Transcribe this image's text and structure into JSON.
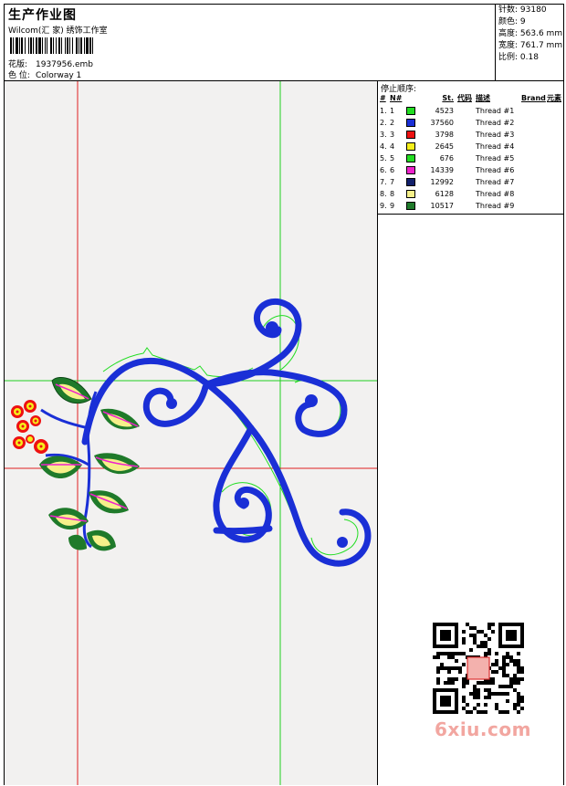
{
  "header": {
    "title": "生产作业图",
    "subtitle": "Wilcom(汇 家) 绣饰工作室",
    "design_label": "花版:",
    "design_value": "1937956.emb",
    "colorway_label": "色 位:",
    "colorway_value": "Colorway 1"
  },
  "stats": [
    {
      "label": "针数:",
      "value": "93180"
    },
    {
      "label": "颜色:",
      "value": "9"
    },
    {
      "label": "高度:",
      "value": "563.6 mm"
    },
    {
      "label": "宽度:",
      "value": "761.7 mm"
    },
    {
      "label": "比例:",
      "value": "0.18"
    }
  ],
  "threads": {
    "title": "停止顺序:",
    "headers": [
      "#",
      "N#",
      "St.",
      "代码",
      "描述",
      "Brand",
      "元素"
    ],
    "rows": [
      {
        "num": "1.",
        "n": "1",
        "color": "#22dd22",
        "stitches": "4523",
        "desc": "Thread #1"
      },
      {
        "num": "2.",
        "n": "2",
        "color": "#1a2fd6",
        "stitches": "37560",
        "desc": "Thread #2"
      },
      {
        "num": "3.",
        "n": "3",
        "color": "#ee1111",
        "stitches": "3798",
        "desc": "Thread #3"
      },
      {
        "num": "4.",
        "n": "4",
        "color": "#f5ef1a",
        "stitches": "2645",
        "desc": "Thread #4"
      },
      {
        "num": "5.",
        "n": "5",
        "color": "#22dd22",
        "stitches": "676",
        "desc": "Thread #5"
      },
      {
        "num": "6.",
        "n": "6",
        "color": "#ee22cc",
        "stitches": "14339",
        "desc": "Thread #6"
      },
      {
        "num": "7.",
        "n": "7",
        "color": "#12206b",
        "stitches": "12992",
        "desc": "Thread #7"
      },
      {
        "num": "8.",
        "n": "8",
        "color": "#f6f08a",
        "stitches": "6128",
        "desc": "Thread #8"
      },
      {
        "num": "9.",
        "n": "9",
        "color": "#1f7a2a",
        "stitches": "10517",
        "desc": "Thread #9"
      }
    ]
  },
  "watermark": "6xiu.com",
  "colors": {
    "canvas_bg": "#f2f1f0",
    "guide_red": "#e02020",
    "guide_green": "#20d020",
    "vine_blue": "#1a2fd6"
  }
}
